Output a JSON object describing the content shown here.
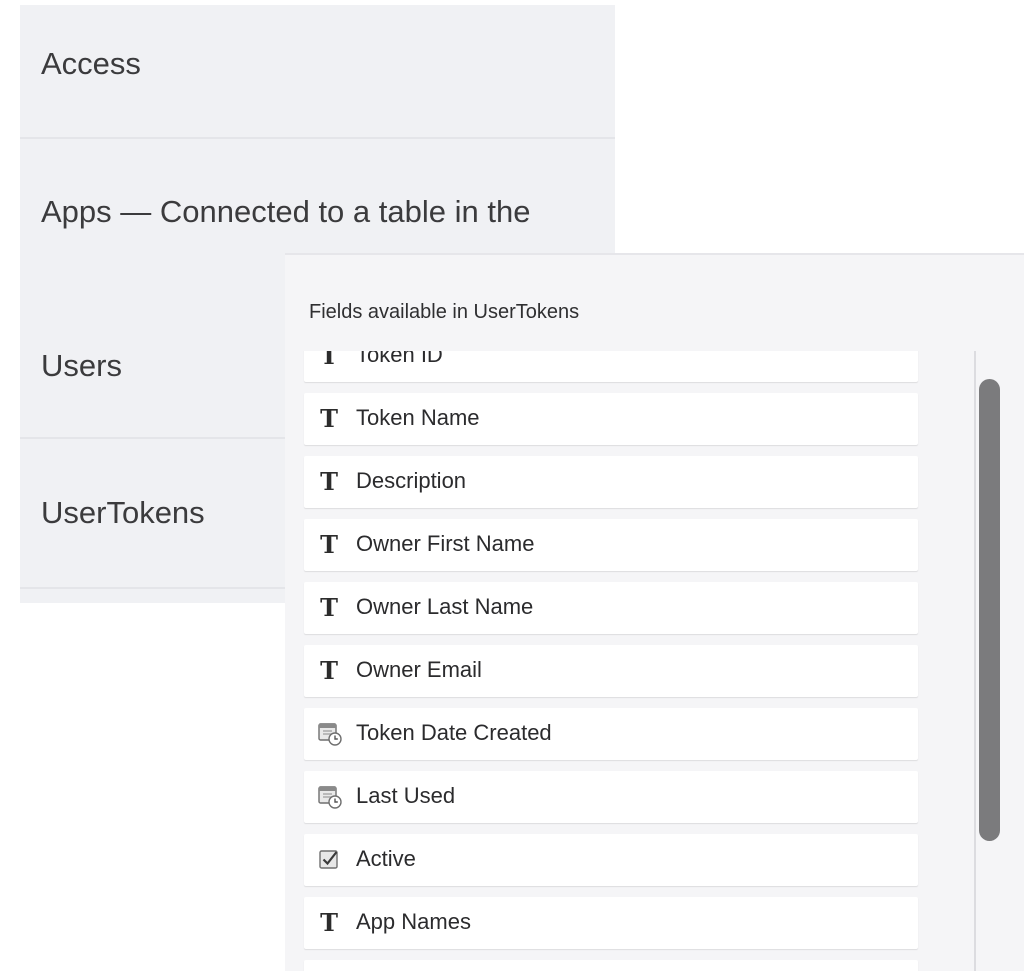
{
  "tables": [
    {
      "label": "Access"
    },
    {
      "label": "Apps — Connected to a table in the"
    },
    {
      "label": "Users"
    },
    {
      "label": "UserTokens"
    }
  ],
  "fields_panel": {
    "title": "Fields available in UserTokens",
    "fields": [
      {
        "label": "Token ID",
        "icon": "text-type-icon",
        "glyph": "T"
      },
      {
        "label": "Token Name",
        "icon": "text-type-icon",
        "glyph": "T"
      },
      {
        "label": "Description",
        "icon": "text-type-icon",
        "glyph": "T"
      },
      {
        "label": "Owner First Name",
        "icon": "text-type-icon",
        "glyph": "T"
      },
      {
        "label": "Owner Last Name",
        "icon": "text-type-icon",
        "glyph": "T"
      },
      {
        "label": "Owner Email",
        "icon": "text-type-icon",
        "glyph": "T"
      },
      {
        "label": "Token Date Created",
        "icon": "calendar-clock-icon",
        "glyph": ""
      },
      {
        "label": "Last Used",
        "icon": "calendar-clock-icon",
        "glyph": ""
      },
      {
        "label": "Active",
        "icon": "checkbox-icon",
        "glyph": ""
      },
      {
        "label": "App Names",
        "icon": "text-type-icon",
        "glyph": "T"
      },
      {
        "label": "",
        "icon": "",
        "glyph": ""
      }
    ]
  }
}
